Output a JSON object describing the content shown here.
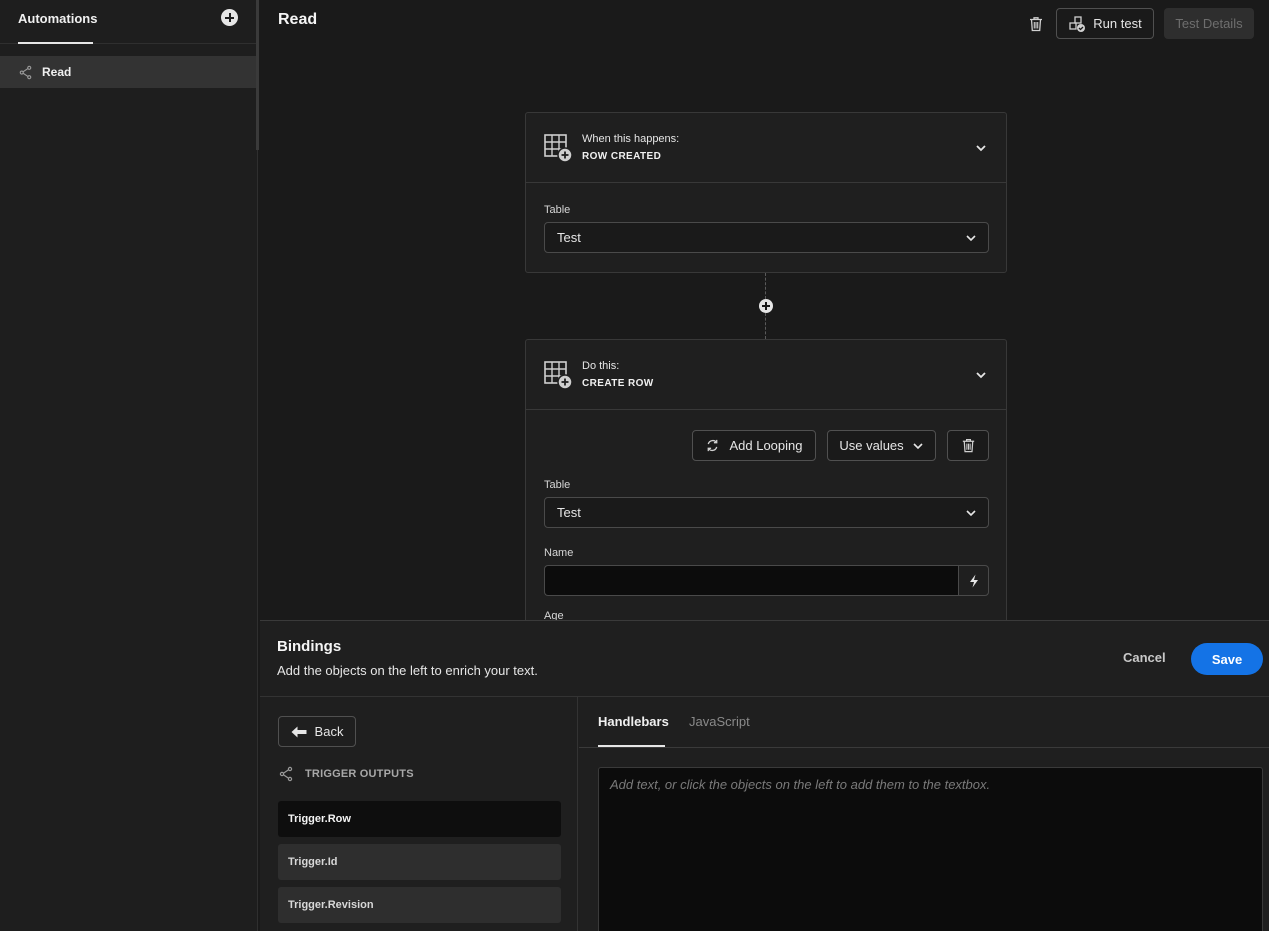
{
  "sidebar": {
    "tab_label": "Automations",
    "items": [
      {
        "label": "Read",
        "icon": "share-icon"
      }
    ]
  },
  "header": {
    "title": "Read",
    "run_test_label": "Run test",
    "test_details_label": "Test Details"
  },
  "trigger_card": {
    "kicker": "When this happens:",
    "name": "ROW CREATED",
    "table_label": "Table",
    "table_value": "Test"
  },
  "action_card": {
    "kicker": "Do this:",
    "name": "CREATE ROW",
    "add_looping_label": "Add Looping",
    "use_values_label": "Use values",
    "table_label": "Table",
    "table_value": "Test",
    "name_label": "Name",
    "name_value": "",
    "age_label": "Age"
  },
  "bindings": {
    "title": "Bindings",
    "subtitle": "Add the objects on the left to enrich your text.",
    "cancel_label": "Cancel",
    "save_label": "Save",
    "back_label": "Back",
    "section_label": "TRIGGER OUTPUTS",
    "items": [
      "Trigger.Row",
      "Trigger.Id",
      "Trigger.Revision"
    ],
    "tabs": [
      "Handlebars",
      "JavaScript"
    ],
    "editor_placeholder": "Add text, or click the objects on the left to add them to the textbox."
  },
  "colors": {
    "accent": "#1473e6",
    "background": "#1a1a1a",
    "panel": "#1f1f1f"
  }
}
